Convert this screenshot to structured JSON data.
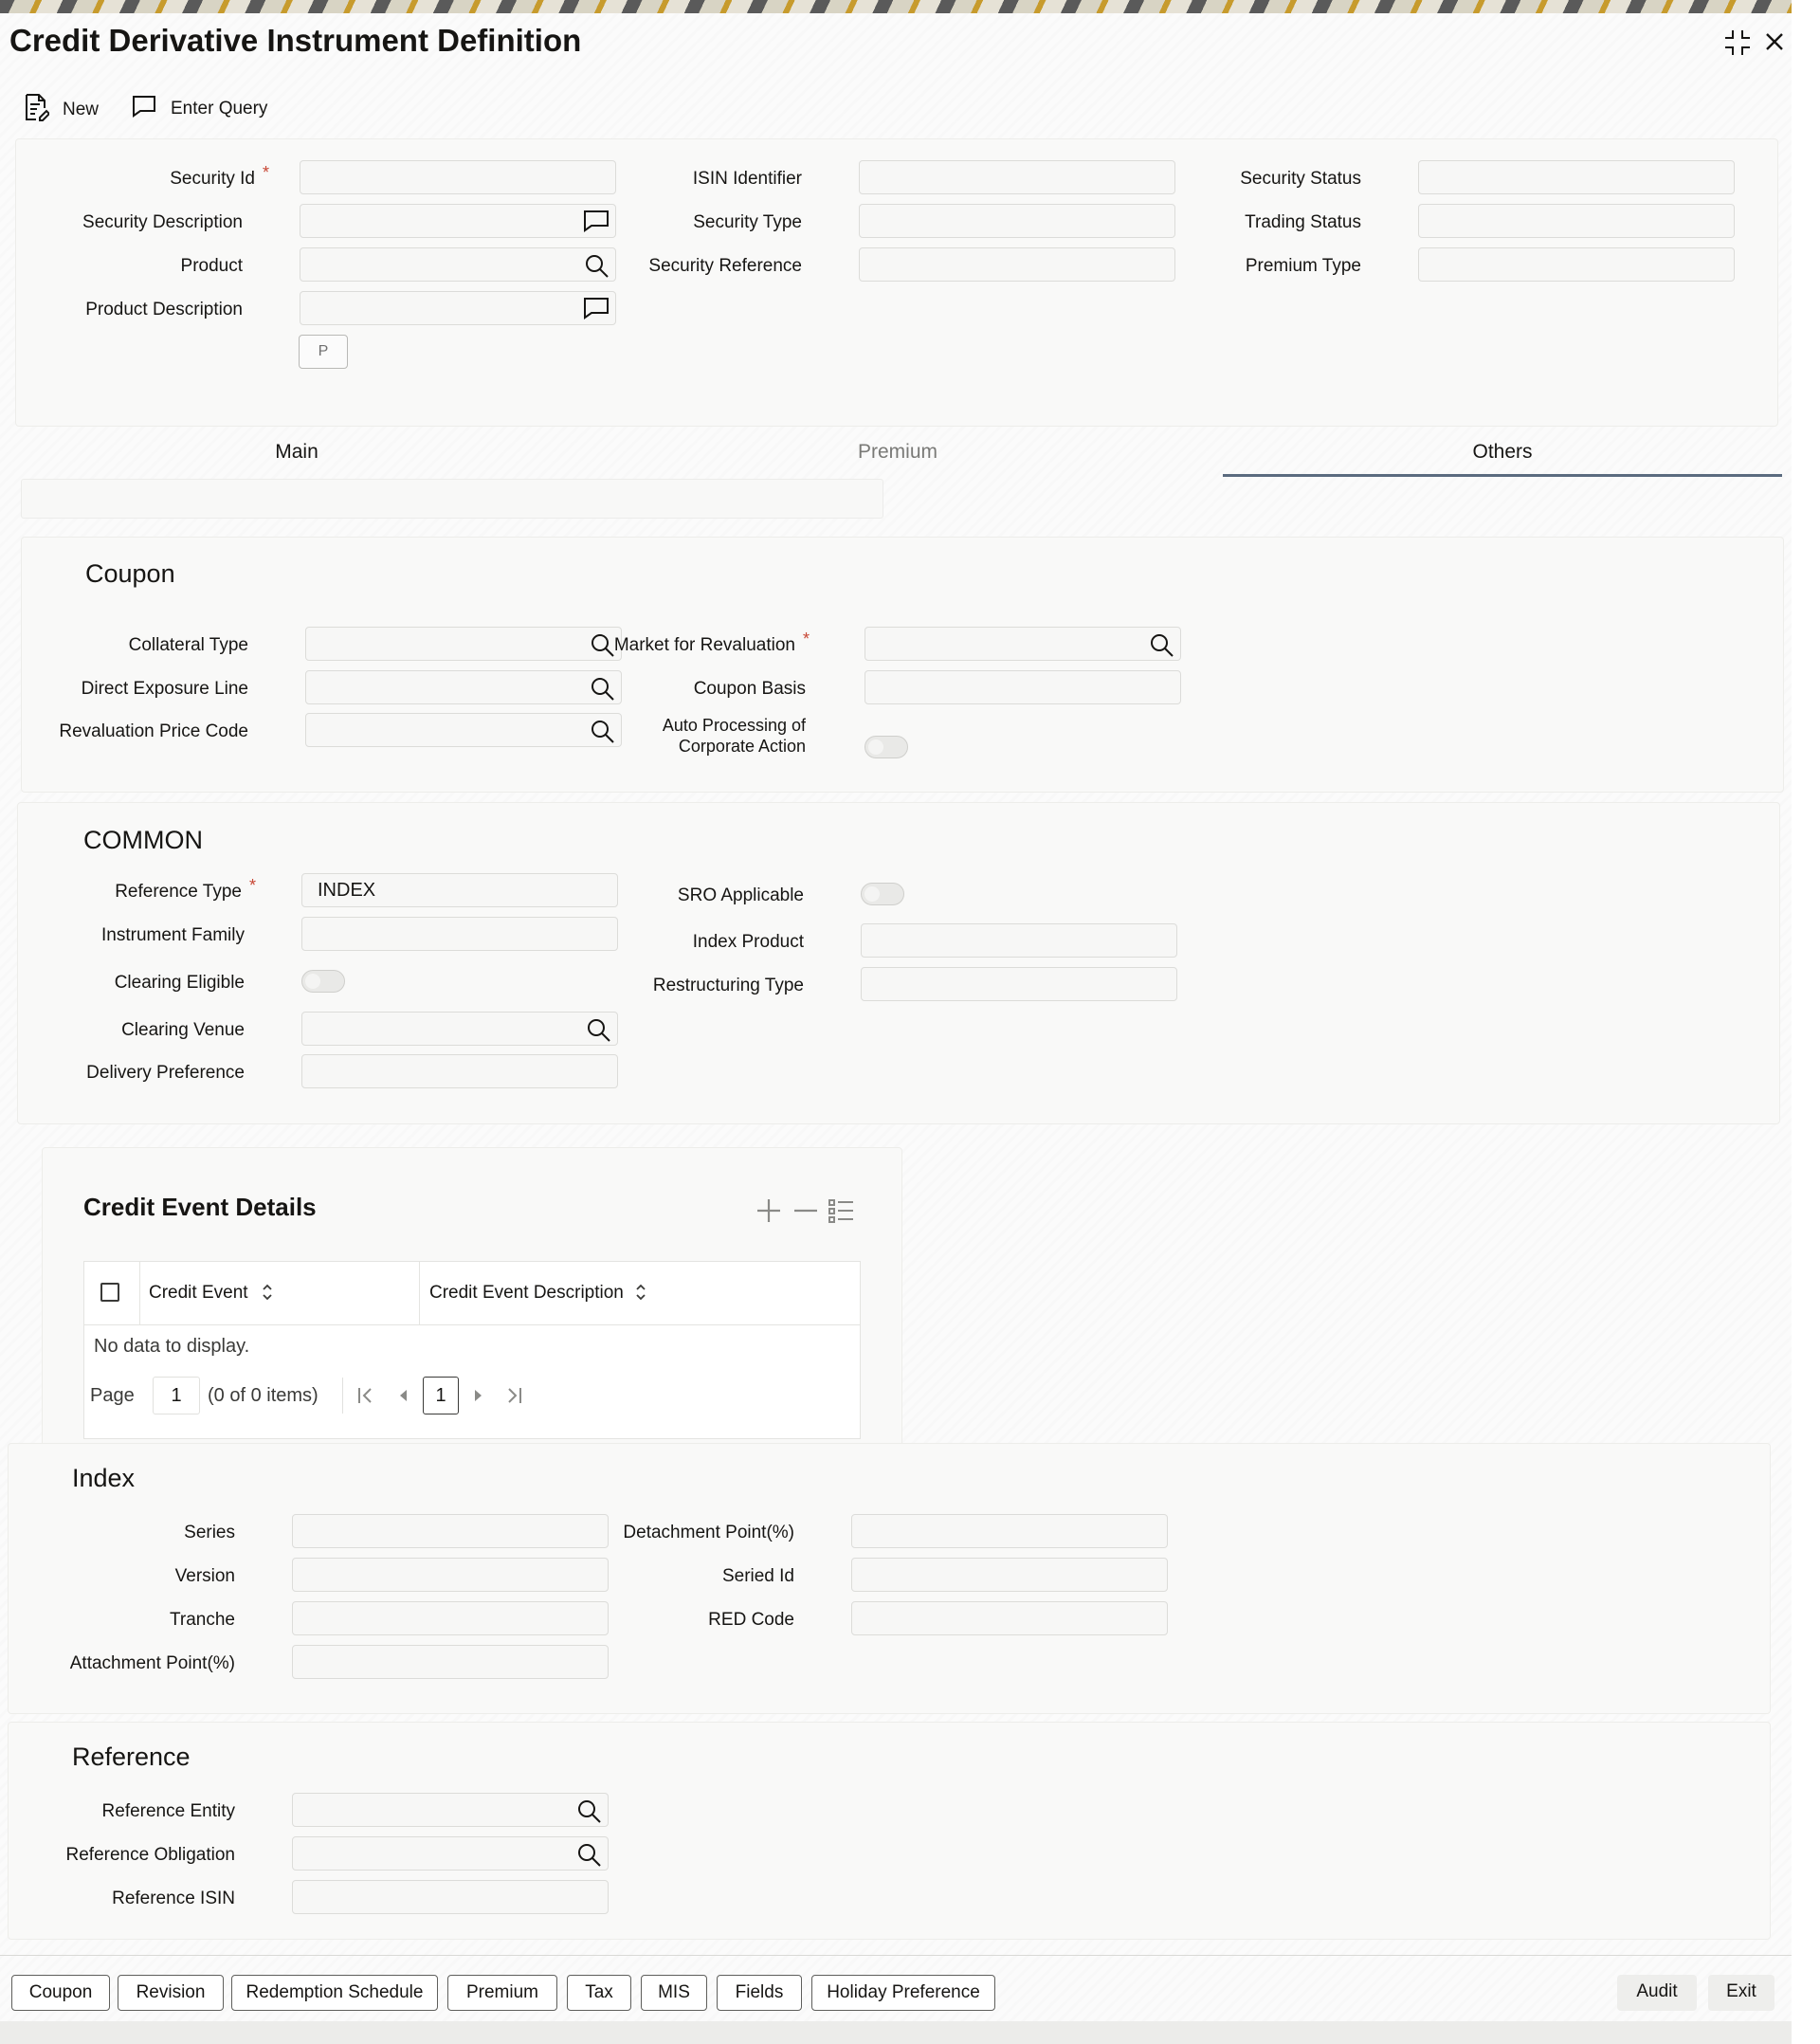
{
  "window": {
    "title": "Credit Derivative Instrument Definition"
  },
  "toolbar": {
    "new_label": "New",
    "enter_query_label": "Enter Query"
  },
  "header_form": {
    "security_id_label": "Security Id",
    "security_description_label": "Security Description",
    "product_label": "Product",
    "product_description_label": "Product Description",
    "p_button_label": "P",
    "isin_identifier_label": "ISIN Identifier",
    "security_type_label": "Security Type",
    "security_reference_label": "Security Reference",
    "security_status_label": "Security Status",
    "trading_status_label": "Trading Status",
    "premium_type_label": "Premium Type",
    "required_marker": "*"
  },
  "tabs": [
    {
      "label": "Main",
      "active": false
    },
    {
      "label": "Premium",
      "active": false
    },
    {
      "label": "Others",
      "active": true
    }
  ],
  "coupon": {
    "title": "Coupon",
    "collateral_type_label": "Collateral Type",
    "direct_exposure_line_label": "Direct Exposure Line",
    "revaluation_price_code_label": "Revaluation Price Code",
    "market_for_revaluation_label": "Market for Revaluation",
    "coupon_basis_label": "Coupon Basis",
    "auto_processing_label_line1": "Auto Processing of",
    "auto_processing_label_line2": "Corporate Action"
  },
  "common": {
    "title": "COMMON",
    "reference_type_label": "Reference Type",
    "reference_type_value": "INDEX",
    "instrument_family_label": "Instrument Family",
    "clearing_eligible_label": "Clearing Eligible",
    "clearing_venue_label": "Clearing Venue",
    "delivery_preference_label": "Delivery Preference",
    "sro_applicable_label": "SRO Applicable",
    "index_product_label": "Index Product",
    "restructuring_type_label": "Restructuring Type"
  },
  "credit_event_details": {
    "title": "Credit Event Details",
    "columns": [
      "Credit Event",
      "Credit Event Description"
    ],
    "empty_text": "No data to display.",
    "page_label": "Page",
    "page_value": "1",
    "items_text": "(0 of 0 items)",
    "current_page": "1"
  },
  "index": {
    "title": "Index",
    "series_label": "Series",
    "version_label": "Version",
    "tranche_label": "Tranche",
    "attachment_point_label": "Attachment Point(%)",
    "detachment_point_label": "Detachment Point(%)",
    "seried_id_label": "Seried Id",
    "red_code_label": "RED Code"
  },
  "reference": {
    "title": "Reference",
    "reference_entity_label": "Reference Entity",
    "reference_obligation_label": "Reference Obligation",
    "reference_isin_label": "Reference ISIN"
  },
  "footer": {
    "buttons": [
      "Coupon",
      "Revision",
      "Redemption Schedule",
      "Premium",
      "Tax",
      "MIS",
      "Fields",
      "Holiday Preference"
    ],
    "audit_label": "Audit",
    "exit_label": "Exit"
  },
  "colors": {
    "required": "#c74634",
    "active_tab_underline": "#5b6b7f",
    "text": "#161513"
  }
}
